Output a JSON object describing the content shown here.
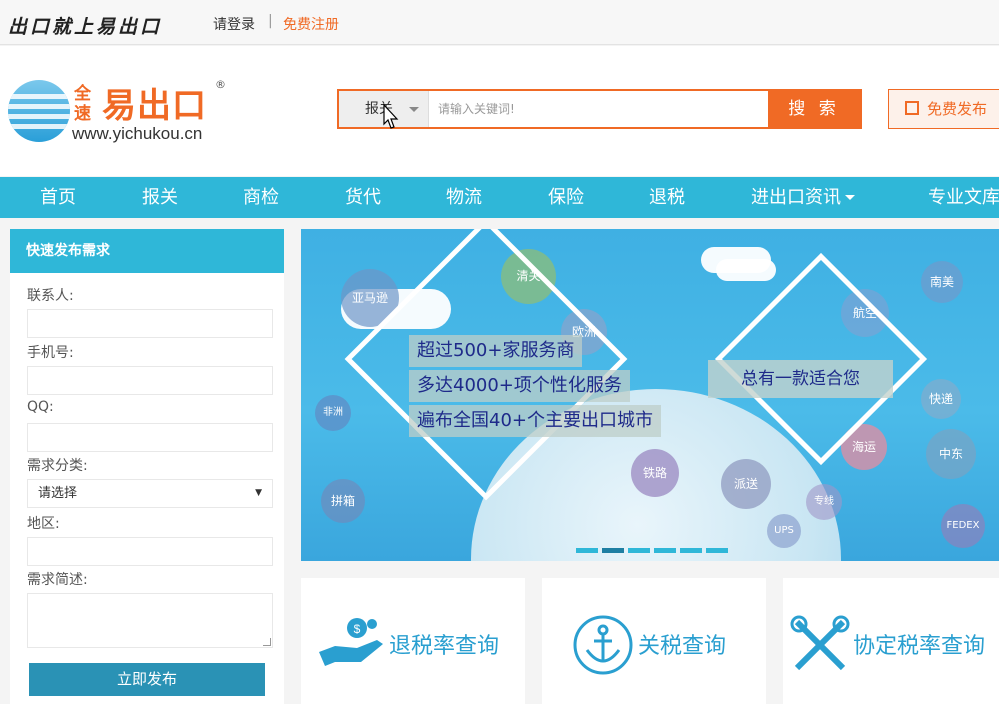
{
  "top": {
    "slogan": "出口就上易出口",
    "login": "请登录",
    "separator": "|",
    "register": "免费注册"
  },
  "logo": {
    "quan": "全",
    "su": "速",
    "main": "易出口",
    "reg": "®",
    "url": "www.yichukou.cn"
  },
  "search": {
    "category": "报关",
    "placeholder": "请输入关键词!",
    "button": "搜 索"
  },
  "publish_btn": "免费发布",
  "nav": [
    {
      "label": "首页"
    },
    {
      "label": "报关"
    },
    {
      "label": "商检"
    },
    {
      "label": "货代"
    },
    {
      "label": "物流"
    },
    {
      "label": "保险"
    },
    {
      "label": "退税"
    },
    {
      "label": "进出口资讯"
    },
    {
      "label": "专业文库"
    }
  ],
  "form": {
    "title": "快速发布需求",
    "contact": "联系人:",
    "phone": "手机号:",
    "qq": "QQ:",
    "category": "需求分类:",
    "category_value": "请选择",
    "region": "地区:",
    "desc": "需求简述:",
    "submit": "立即发布"
  },
  "banner": {
    "line1": "超过500+家服务商",
    "line2": "多达4000+项个性化服务",
    "line3": "遍布全国40+个主要出口城市",
    "right": "总有一款适合您",
    "bubbles": [
      "清关",
      "亚马逊",
      "非洲",
      "拼箱",
      "铁路",
      "派送",
      "海运",
      "FEDEX",
      "UPS",
      "南美",
      "中东",
      "快递",
      "专线",
      "航空",
      "欧洲"
    ],
    "active_slide": 1
  },
  "tiles": [
    {
      "label": "退税率查询",
      "icon": "hand-coin-icon"
    },
    {
      "label": "关税查询",
      "icon": "anchor-icon"
    },
    {
      "label": "协定税率查询",
      "icon": "tools-icon"
    }
  ],
  "colors": {
    "accent": "#f06a25",
    "nav": "#2fb7d8",
    "submit": "#2a92b5"
  }
}
